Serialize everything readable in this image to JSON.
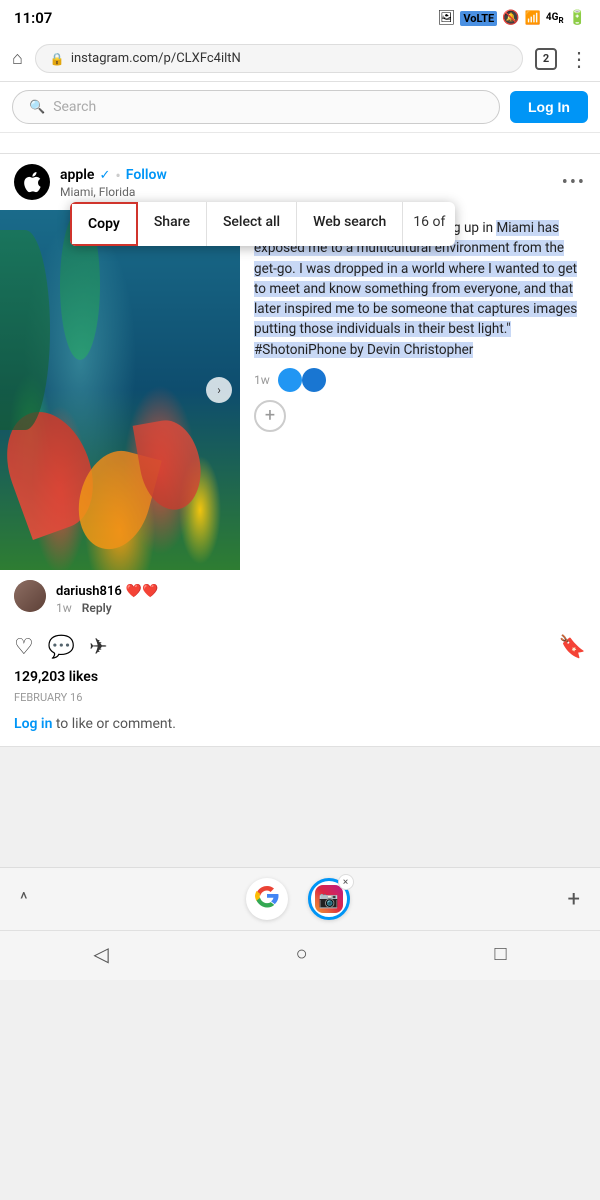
{
  "status_bar": {
    "time": "11:07",
    "volte": "VoLTE",
    "tab_count": "2"
  },
  "browser": {
    "address": "instagram.com/p/CLXFc4iltN",
    "home_icon": "⌂",
    "lock_icon": "🔒",
    "menu_icon": "⋮"
  },
  "search_bar": {
    "placeholder": "Search",
    "search_icon": "🔍",
    "login_label": "Log In"
  },
  "post": {
    "username": "apple",
    "verified": "✓",
    "follow": "Follow",
    "location": "Miami, Florida",
    "more_icon": "•••",
    "caption_prefix": "Commissioned by Apple. \"Growing up in Miami has exposed me to a multicultural environment from the get-go. I was dropped in a world where I wanted to get to meet and know something from everyone, and that later inspired me to be someone that captures images putting those individuals in their best light.\" #ShotoniPhone by Devin Christopher",
    "caption_selected_start": "Miami has exposed me to a multicultural environment from the get-go. I was dropped in a world where I wanted to get to meet and know something from everyone, and that later inspired me to be someone that captures images putting those individuals in their best light.\" #ShotoniPhone by Devin Christopher",
    "time_ago": "1w",
    "commenter_name": "dariush816",
    "commenter_hearts": "❤️❤️",
    "comment_time": "1w",
    "reply_label": "Reply",
    "likes": "129,203 likes",
    "date": "February 16",
    "login_to_like": "Log in",
    "login_to_like_suffix": " to like or comment.",
    "next_btn": "›"
  },
  "text_toolbar": {
    "copy_label": "Copy",
    "share_label": "Share",
    "select_all_label": "Select all",
    "web_search_label": "Web search",
    "overflow": "16 of"
  },
  "bottom_bar": {
    "chevron_up": "^",
    "plus_label": "+",
    "close_x": "×"
  },
  "nav_bar": {
    "back": "◁",
    "home": "○",
    "square": "□"
  }
}
